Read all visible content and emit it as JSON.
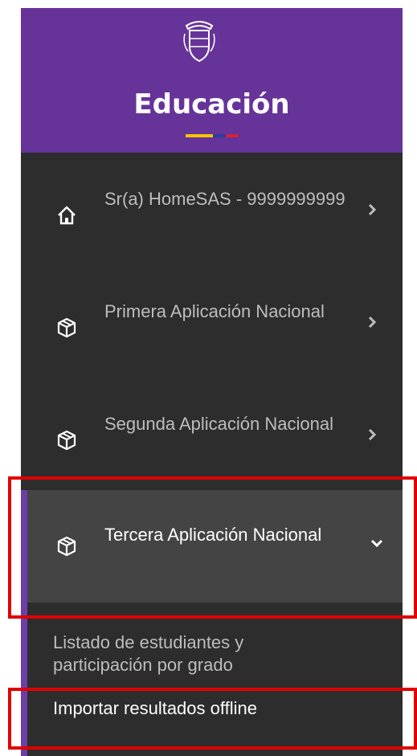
{
  "header": {
    "brand_label": "Educación"
  },
  "menu": {
    "items": [
      {
        "label": "Sr(a) HomeSAS - 9999999999",
        "icon": "home-icon"
      },
      {
        "label": "Primera Aplicación Nacional",
        "icon": "package-icon"
      },
      {
        "label": "Segunda Aplicación Nacional",
        "icon": "package-icon"
      },
      {
        "label": "Tercera Aplicación Nacional",
        "icon": "package-icon",
        "expanded": true
      }
    ],
    "subitems": [
      {
        "label": "Listado de estudiantes y participación por grado"
      },
      {
        "label": "Importar resultados offline"
      }
    ]
  },
  "colors": {
    "header": "#663399",
    "sidebar": "#2d2d2d",
    "active_item": "#444444",
    "accent": "#6b3fa5",
    "highlight_box": "#e00000",
    "flag_yellow": "#f5c400",
    "flag_blue": "#2a3fa0",
    "flag_red": "#d4213d"
  }
}
